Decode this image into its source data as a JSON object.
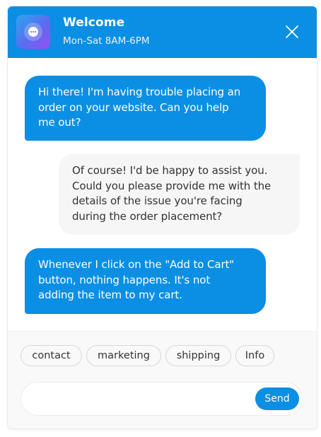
{
  "colors": {
    "primary": "#0a8fe4",
    "agent_bubble": "#f6f6f6",
    "panel": "#f9f9f9"
  },
  "header": {
    "title": "Welcome",
    "hours": "Mon-Sat 8AM-6PM",
    "avatar_icon": "chat-bubble-icon",
    "close_icon": "close-icon"
  },
  "messages": [
    {
      "sender": "user",
      "lines": [
        "Hi there! I'm having trouble placing an",
        "order on your website. Can you help",
        "me out?"
      ]
    },
    {
      "sender": "agent",
      "lines": [
        "Of course! I'd be happy to assist you.",
        "Could you please provide me with the",
        "details of the issue you're facing",
        "during the order placement?"
      ]
    },
    {
      "sender": "user",
      "lines": [
        "Whenever I click on the \"Add to Cart\"",
        "button, nothing happens. It's not",
        "adding the item to my cart."
      ]
    }
  ],
  "quick_replies": [
    "contact",
    "marketing",
    "shipping",
    "Info"
  ],
  "composer": {
    "value": "",
    "placeholder": "",
    "send_label": "Send"
  }
}
